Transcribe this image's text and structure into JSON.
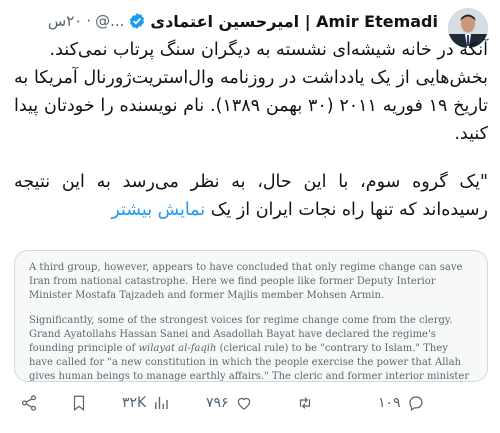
{
  "tweet": {
    "author_name": "Amir Etemadi | امیرحسین اعتمادی",
    "handle": "@...",
    "time": "۲۰س",
    "body_lines": [
      "آنکه در خانه شیشه‌ای نشسته به دیگران سنگ پرتاب نمی‌کند.",
      "بخش‌هایی از یک یادداشت در روزنامه وال‌استریت‌ژورنال آمریکا به تاریخ ۱۹ فوریه ۲۰۱۱ (۳۰ بهمن ۱۳۸۹). نام نویسنده را خودتان پیدا کنید.",
      "\"یک گروه سوم، با این حال، به نظر می‌رسد به این نتیجه رسیده‌اند که تنها راه نجات ایران از یک"
    ],
    "show_more": "نمایش بیشتر"
  },
  "card": {
    "para1": "A third group, however, appears to have concluded that only regime change can save Iran from national catastrophe. Here we find people like former Deputy Interior Minister Mostafa Tajzadeh and former Majlis member Mohsen Armin.",
    "para2_a": "Significantly, some of the strongest voices for regime change come from the clergy. Grand Ayatollahs Hassan Sanei and Asadollah Bayat have declared the regime's founding principle of ",
    "para2_em": "wilayat al-faqih",
    "para2_b": " (clerical rule) to be \"contrary to Islam.\" They have called for \"a new constitution in which the people exercise the power that Allah gives human beings to manage earthly affairs.\" The cleric and former interior minister Abdallah Noori has also called for \"a new departure with the people in the driving seat.\""
  },
  "actions": {
    "replies": "۱۰۹",
    "retweets": "۷۹۶",
    "views": "۳۲K"
  },
  "colors": {
    "accent": "#1d9bf0",
    "muted": "#536471"
  }
}
